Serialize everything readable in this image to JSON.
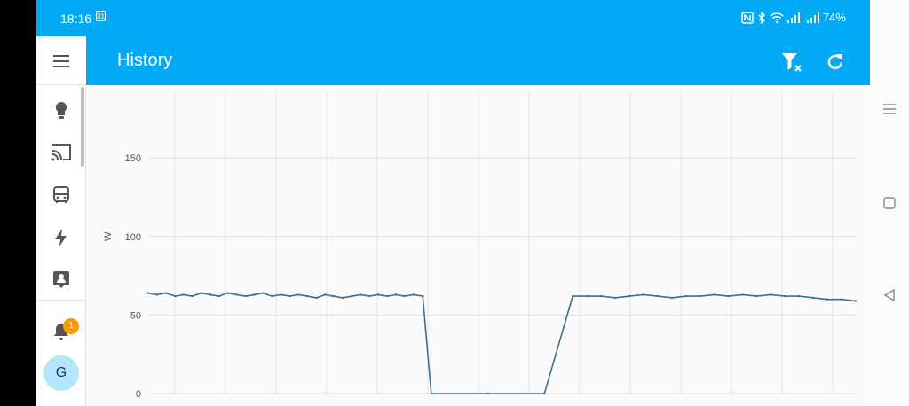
{
  "status_bar": {
    "time": "18:16",
    "calendar_day": "31",
    "battery": "74%"
  },
  "app_bar": {
    "title": "History"
  },
  "sidebar": {
    "items": [
      {
        "icon": "lightbulb-icon"
      },
      {
        "icon": "cast-icon"
      },
      {
        "icon": "bus-icon"
      },
      {
        "icon": "lightning-icon"
      },
      {
        "icon": "account-box-icon"
      }
    ],
    "notification_count": "1",
    "avatar_initial": "G"
  },
  "colors": {
    "accent": "#03a9f4",
    "series": "#3c6e96",
    "badge": "#ff9800"
  },
  "chart_data": {
    "type": "line",
    "ylabel": "W",
    "yticks": [
      0,
      50,
      100,
      150
    ],
    "ylim": [
      0,
      193
    ],
    "series": [
      {
        "values": [
          [
            0.0,
            64
          ],
          [
            0.012,
            63
          ],
          [
            0.025,
            64
          ],
          [
            0.038,
            62
          ],
          [
            0.05,
            63
          ],
          [
            0.062,
            62
          ],
          [
            0.075,
            64
          ],
          [
            0.088,
            63
          ],
          [
            0.1,
            62
          ],
          [
            0.112,
            64
          ],
          [
            0.125,
            63
          ],
          [
            0.138,
            62
          ],
          [
            0.15,
            63
          ],
          [
            0.162,
            64
          ],
          [
            0.175,
            62
          ],
          [
            0.188,
            63
          ],
          [
            0.2,
            62
          ],
          [
            0.212,
            63
          ],
          [
            0.225,
            62
          ],
          [
            0.238,
            61
          ],
          [
            0.25,
            63
          ],
          [
            0.262,
            62
          ],
          [
            0.275,
            61
          ],
          [
            0.288,
            62
          ],
          [
            0.3,
            63
          ],
          [
            0.312,
            62
          ],
          [
            0.325,
            63
          ],
          [
            0.338,
            62
          ],
          [
            0.35,
            63
          ],
          [
            0.362,
            62
          ],
          [
            0.375,
            63
          ],
          [
            0.388,
            62
          ],
          [
            0.4,
            0
          ],
          [
            0.48,
            0
          ],
          [
            0.56,
            0
          ],
          [
            0.6,
            62
          ],
          [
            0.62,
            62
          ],
          [
            0.64,
            62
          ],
          [
            0.66,
            61
          ],
          [
            0.68,
            62
          ],
          [
            0.7,
            63
          ],
          [
            0.72,
            62
          ],
          [
            0.74,
            61
          ],
          [
            0.76,
            62
          ],
          [
            0.78,
            62
          ],
          [
            0.8,
            63
          ],
          [
            0.82,
            62
          ],
          [
            0.84,
            63
          ],
          [
            0.86,
            62
          ],
          [
            0.88,
            63
          ],
          [
            0.9,
            62
          ],
          [
            0.92,
            62
          ],
          [
            0.94,
            61
          ],
          [
            0.96,
            60
          ],
          [
            0.98,
            60
          ],
          [
            1.0,
            59
          ]
        ]
      }
    ],
    "grid": true
  }
}
